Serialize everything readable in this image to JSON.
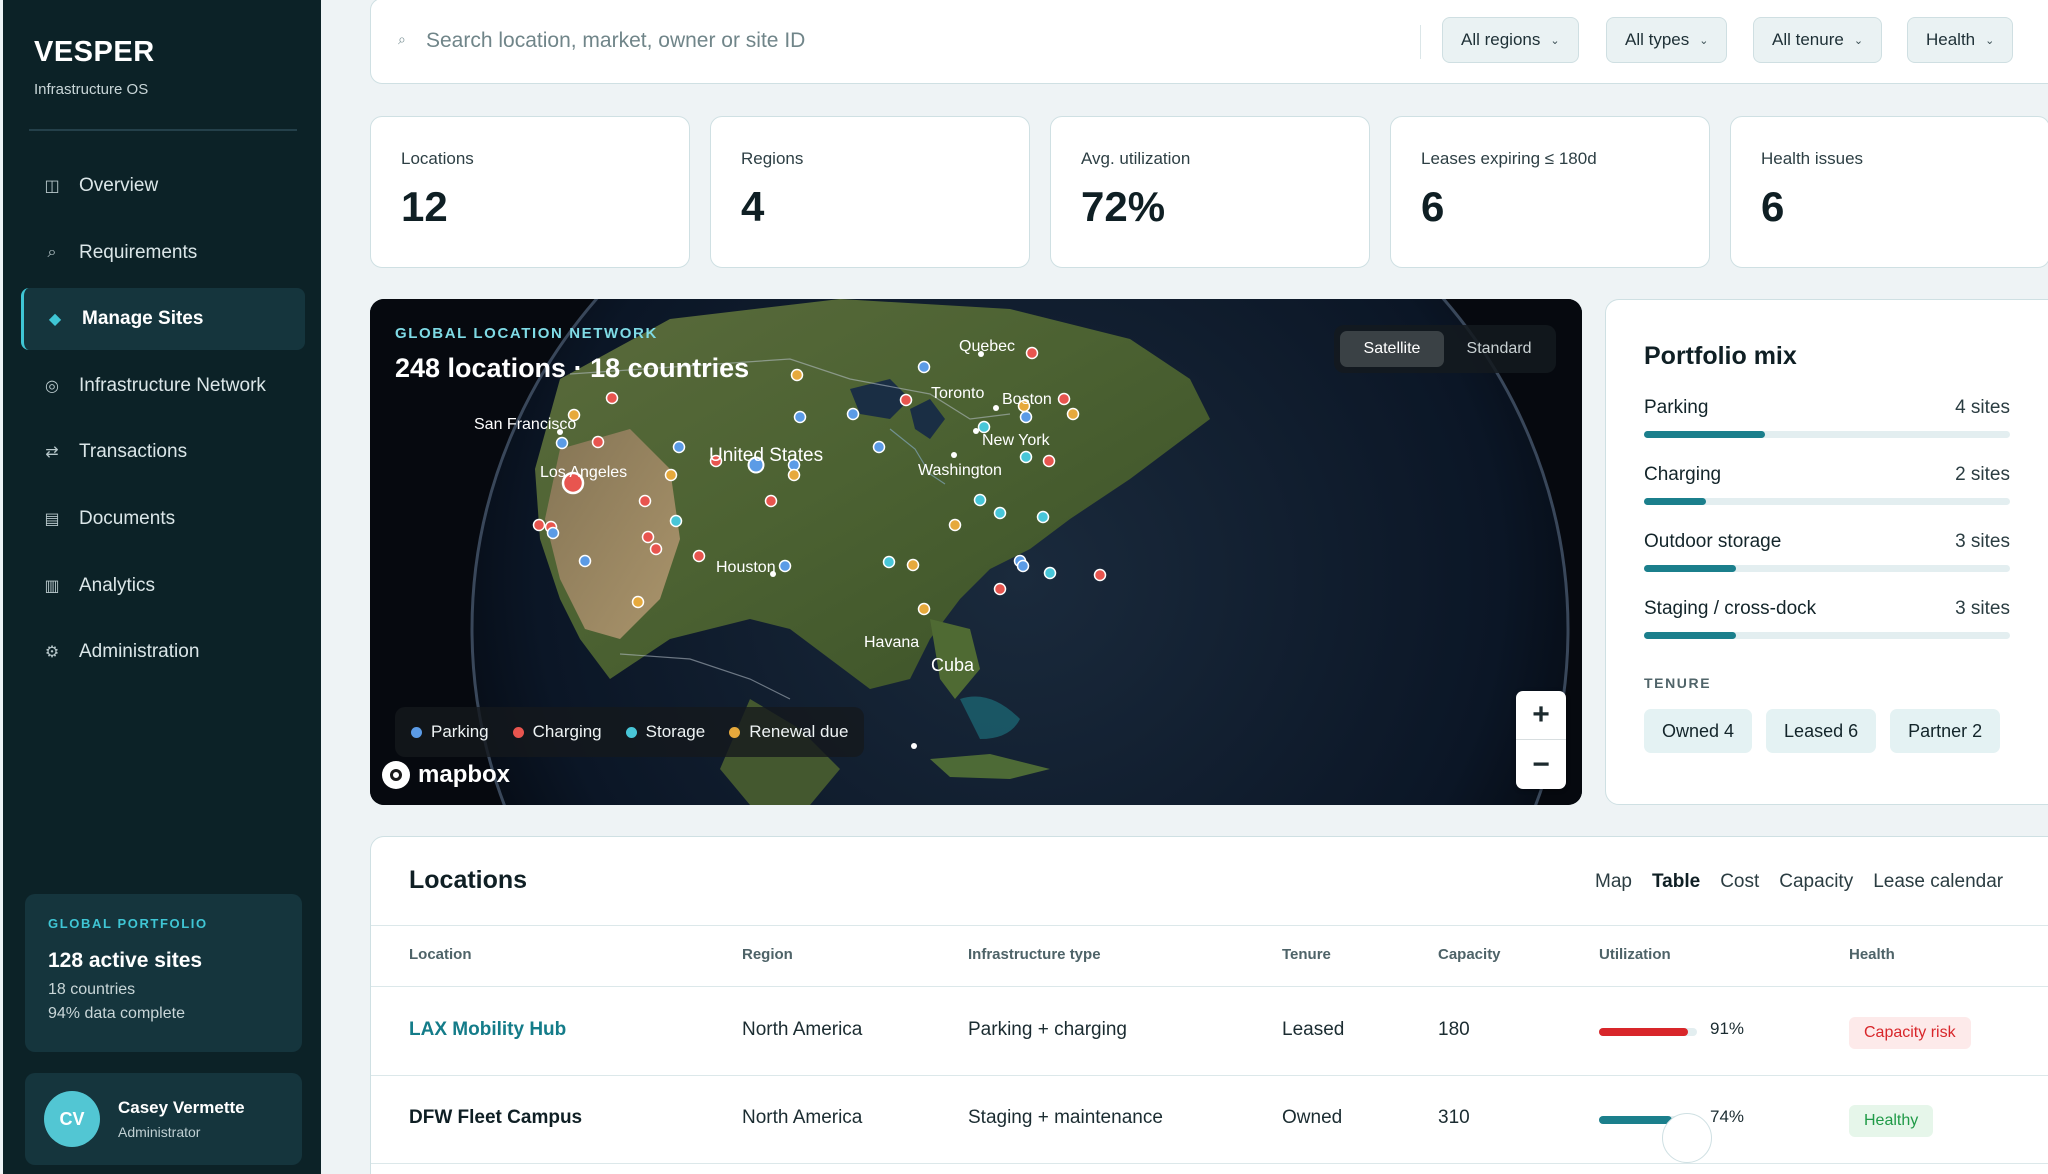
{
  "app": {
    "name": "VESPER",
    "subtitle": "Infrastructure OS"
  },
  "sidebar": {
    "items": [
      {
        "label": "Overview",
        "icon": "◫"
      },
      {
        "label": "Requirements",
        "icon": "⌕"
      },
      {
        "label": "Manage Sites",
        "icon": "◆"
      },
      {
        "label": "Infrastructure Network",
        "icon": "◎"
      },
      {
        "label": "Transactions",
        "icon": "⇄"
      },
      {
        "label": "Documents",
        "icon": "▤"
      },
      {
        "label": "Analytics",
        "icon": "▥"
      },
      {
        "label": "Administration",
        "icon": "⚙"
      }
    ],
    "active_index": 2,
    "portfolio": {
      "eyebrow": "GLOBAL PORTFOLIO",
      "title": "128 active sites",
      "line1": "18 countries",
      "line2": "94% data complete"
    },
    "user": {
      "initials": "CV",
      "name": "Casey Vermette",
      "role": "Administrator"
    }
  },
  "search": {
    "placeholder": "Search location, market, owner or site ID",
    "icon": "search-icon",
    "filters": [
      "All regions",
      "All types",
      "All tenure",
      "Health"
    ]
  },
  "kpis": [
    {
      "label": "Locations",
      "value": "12"
    },
    {
      "label": "Regions",
      "value": "4"
    },
    {
      "label": "Avg. utilization",
      "value": "72%"
    },
    {
      "label": "Leases expiring ≤ 180d",
      "value": "6"
    },
    {
      "label": "Health issues",
      "value": "6"
    }
  ],
  "map": {
    "eyebrow": "GLOBAL LOCATION NETWORK",
    "title": "248 locations · 18 countries",
    "view_toggle": {
      "active": "Satellite",
      "inactive": "Standard"
    },
    "legend": [
      {
        "label": "Parking",
        "color": "#5b9be6"
      },
      {
        "label": "Charging",
        "color": "#e8554f"
      },
      {
        "label": "Storage",
        "color": "#48c6d8"
      },
      {
        "label": "Renewal due",
        "color": "#e6a93c"
      }
    ],
    "zoom_in": "+",
    "zoom_out": "−",
    "attribution": "mapbox",
    "place_labels": [
      "Quebec",
      "Toronto",
      "Boston",
      "San Francisco",
      "New York",
      "United States",
      "Los Angeles",
      "Washington",
      "Houston",
      "Havana",
      "Cuba"
    ]
  },
  "portfolio_mix": {
    "title": "Portfolio mix",
    "rows": [
      {
        "label": "Parking",
        "count": "4 sites",
        "fill": 0.33
      },
      {
        "label": "Charging",
        "count": "2 sites",
        "fill": 0.17
      },
      {
        "label": "Outdoor storage",
        "count": "3 sites",
        "fill": 0.25
      },
      {
        "label": "Staging / cross-dock",
        "count": "3 sites",
        "fill": 0.25
      }
    ],
    "tenure_label": "TENURE",
    "tenure_chips": [
      "Owned 4",
      "Leased 6",
      "Partner 2"
    ]
  },
  "locations": {
    "title": "Locations",
    "tabs": [
      "Map",
      "Table",
      "Cost",
      "Capacity",
      "Lease calendar"
    ],
    "active_tab": "Table",
    "columns": [
      "Location",
      "Region",
      "Infrastructure type",
      "Tenure",
      "Capacity",
      "Utilization",
      "Health"
    ],
    "rows": [
      {
        "name": "LAX Mobility Hub",
        "region": "North America",
        "type": "Parking + charging",
        "tenure": "Leased",
        "capacity": "180",
        "utilization": "91%",
        "util_value": 0.91,
        "util_color": "#d8262a",
        "health": "Capacity risk",
        "health_kind": "risk"
      },
      {
        "name": "DFW Fleet Campus",
        "region": "North America",
        "type": "Staging + maintenance",
        "tenure": "Owned",
        "capacity": "310",
        "utilization": "74%",
        "util_value": 0.74,
        "util_color": "#1b7f8c",
        "health": "Healthy",
        "health_kind": "healthy"
      }
    ]
  }
}
